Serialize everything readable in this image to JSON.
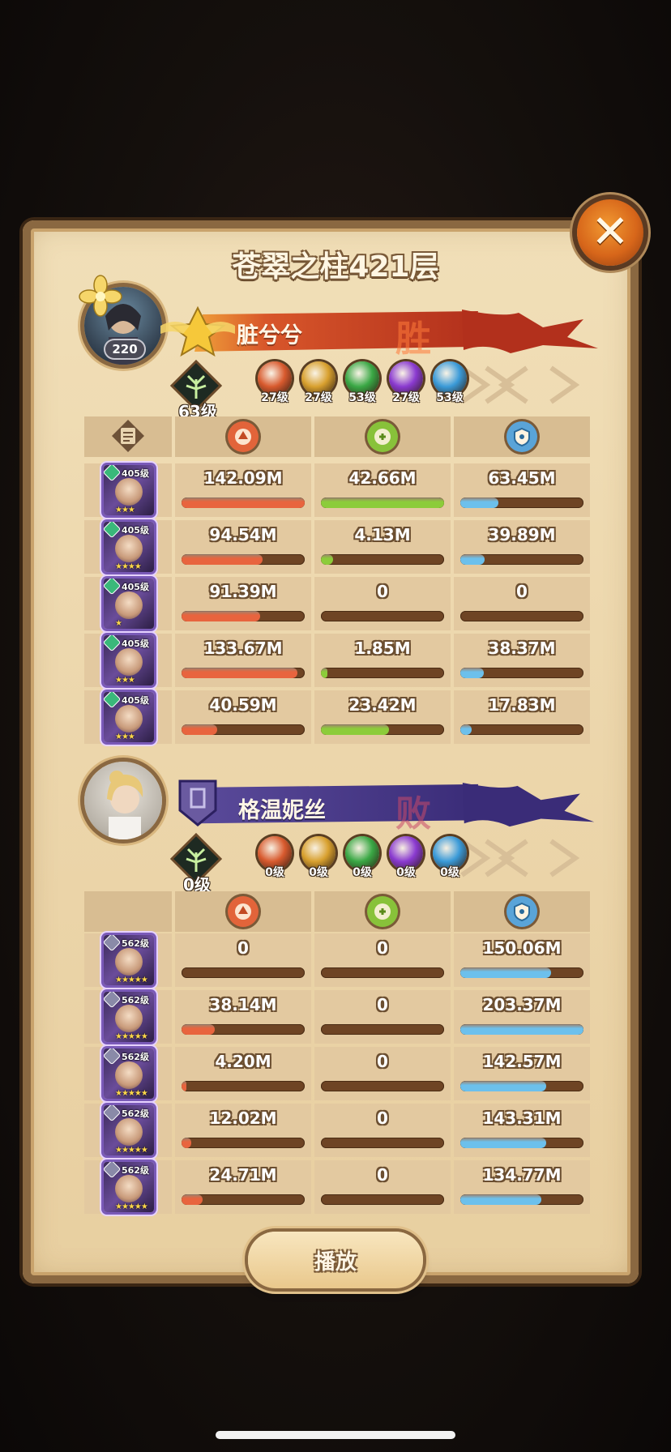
{
  "title": "苍翠之柱421层",
  "close_label": "✕",
  "play_label": "播放",
  "stat_headers": [
    {
      "icon": "damage-icon",
      "color": "#e2643a"
    },
    {
      "icon": "heal-icon",
      "color": "#88c23a"
    },
    {
      "icon": "shield-icon",
      "color": "#5aa4d8"
    }
  ],
  "team1": {
    "name": "脏兮兮",
    "result": "胜",
    "player_level": "220",
    "resonance_level": "63级",
    "banner_color": "#c94424",
    "factions": [
      {
        "icon": "lightbearer-faction-icon",
        "level": "27级",
        "color": "#d85a2e"
      },
      {
        "icon": "mauler-faction-icon",
        "level": "27级",
        "color": "#d8a02e"
      },
      {
        "icon": "wilder-faction-icon",
        "level": "53级",
        "color": "#3aa845"
      },
      {
        "icon": "graveborn-faction-icon",
        "level": "27级",
        "color": "#8a3ad0"
      },
      {
        "icon": "celestial-faction-icon",
        "level": "53级",
        "color": "#3a9ad8"
      }
    ],
    "heroes": [
      {
        "level": "405级",
        "stars": "★★★",
        "damage": "142.09M",
        "heal": "42.66M",
        "shield": "63.45M",
        "damage_ratio": 1.0,
        "heal_ratio": 1.0,
        "shield_ratio": 0.31
      },
      {
        "level": "405级",
        "stars": "★★★★",
        "damage": "94.54M",
        "heal": "4.13M",
        "shield": "39.89M",
        "damage_ratio": 0.66,
        "heal_ratio": 0.1,
        "shield_ratio": 0.2
      },
      {
        "level": "405级",
        "stars": "★",
        "damage": "91.39M",
        "heal": "0",
        "shield": "0",
        "damage_ratio": 0.64,
        "heal_ratio": 0,
        "shield_ratio": 0
      },
      {
        "level": "405级",
        "stars": "★★★",
        "damage": "133.67M",
        "heal": "1.85M",
        "shield": "38.37M",
        "damage_ratio": 0.94,
        "heal_ratio": 0.05,
        "shield_ratio": 0.19
      },
      {
        "level": "405级",
        "stars": "★★★",
        "damage": "40.59M",
        "heal": "23.42M",
        "shield": "17.83M",
        "damage_ratio": 0.29,
        "heal_ratio": 0.55,
        "shield_ratio": 0.09
      }
    ]
  },
  "team2": {
    "name": "格温妮丝",
    "result": "败",
    "resonance_level": "0级",
    "banner_color": "#4a3a8e",
    "factions": [
      {
        "icon": "lightbearer-faction-icon",
        "level": "0级",
        "color": "#d85a2e"
      },
      {
        "icon": "mauler-faction-icon",
        "level": "0级",
        "color": "#d8a02e"
      },
      {
        "icon": "wilder-faction-icon",
        "level": "0级",
        "color": "#3aa845"
      },
      {
        "icon": "graveborn-faction-icon",
        "level": "0级",
        "color": "#8a3ad0"
      },
      {
        "icon": "celestial-faction-icon",
        "level": "0级",
        "color": "#3a9ad8"
      }
    ],
    "heroes": [
      {
        "level": "562级",
        "stars": "★★★★★",
        "damage": "0",
        "heal": "0",
        "shield": "150.06M",
        "damage_ratio": 0,
        "heal_ratio": 0,
        "shield_ratio": 0.74
      },
      {
        "level": "562级",
        "stars": "★★★★★",
        "damage": "38.14M",
        "heal": "0",
        "shield": "203.37M",
        "damage_ratio": 0.27,
        "heal_ratio": 0,
        "shield_ratio": 1.0
      },
      {
        "level": "562级",
        "stars": "★★★★★",
        "damage": "4.20M",
        "heal": "0",
        "shield": "142.57M",
        "damage_ratio": 0.03,
        "heal_ratio": 0,
        "shield_ratio": 0.7
      },
      {
        "level": "562级",
        "stars": "★★★★★",
        "damage": "12.02M",
        "heal": "0",
        "shield": "143.31M",
        "damage_ratio": 0.08,
        "heal_ratio": 0,
        "shield_ratio": 0.7
      },
      {
        "level": "562级",
        "stars": "★★★★★",
        "damage": "24.71M",
        "heal": "0",
        "shield": "134.77M",
        "damage_ratio": 0.17,
        "heal_ratio": 0,
        "shield_ratio": 0.66
      }
    ]
  },
  "colors": {
    "damage_bar": "#e8643e",
    "heal_bar": "#8ccc3a",
    "shield_bar": "#6cc0ec"
  }
}
